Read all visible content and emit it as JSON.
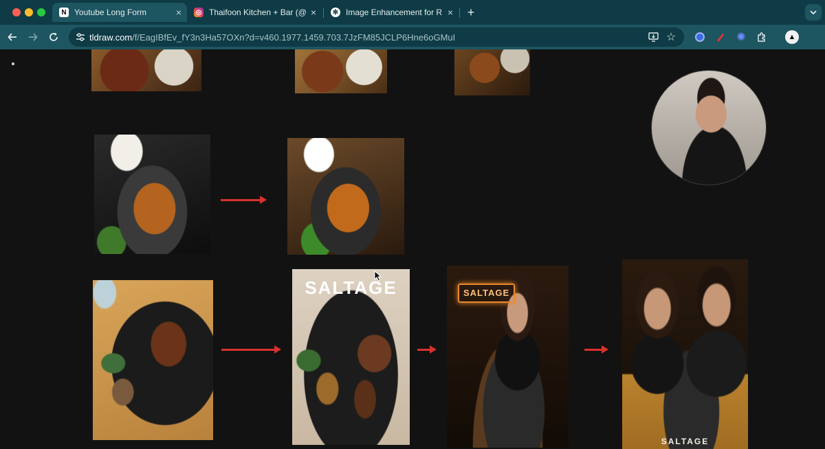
{
  "tabs": [
    {
      "title": "Youtube Long Form",
      "favicon": "notion-icon",
      "active": true
    },
    {
      "title": "Thaifoon Kitchen + Bar (@tha",
      "favicon": "instagram-icon",
      "active": false
    },
    {
      "title": "Image Enhancement for Resta",
      "favicon": "chatgpt-icon",
      "active": false
    }
  ],
  "new_tab_label": "+",
  "address": {
    "domain": "tldraw.com",
    "path": "/f/EagIBfEv_fY3n3Ha57OXn?d=v460.1977.1459.703.7JzFM85JCLP6Hne6oGMuI"
  },
  "canvas": {
    "brand_text": "SALTAGE"
  },
  "colors": {
    "tab_bg": "#0e3b45",
    "toolbar_bg": "#1d5561",
    "canvas_bg": "#121212",
    "arrow": "#d8322e"
  }
}
